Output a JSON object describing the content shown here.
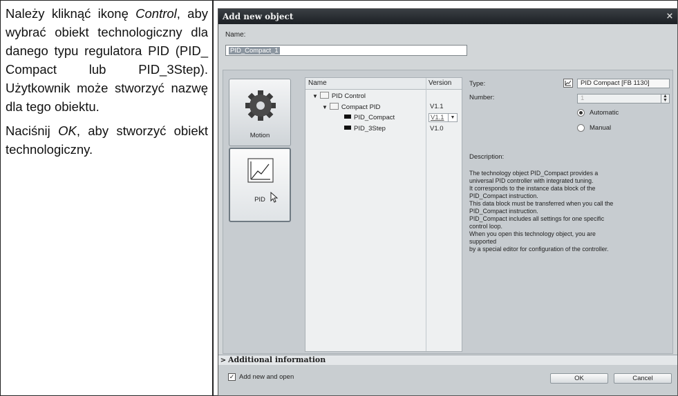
{
  "instructions": {
    "para1": "Należy kliknąć ikonę Control, aby wybrać obiekt technologiczny dla danego typu regulatora PID (PID_Compact lub PID_3Step). Użytkownik może stworzyć nazwę dla tego obiektu.",
    "para1_before": "Należy kliknąć ikonę ",
    "para1_em": "Control",
    "para1_after": ", aby wybrać obiekt technologiczny dla danego typu regulatora PID (PID_ Compact lub PID_3Step). Użytkownik może stworzyć nazwę dla tego obiektu.",
    "para2_before": "Naciśnij ",
    "para2_em": "OK",
    "para2_after": ", aby stworzyć obiekt technologiczny."
  },
  "dialog": {
    "title": "Add new object",
    "close_glyph": "×",
    "name_label": "Name:",
    "name_value": "PID_Compact_1",
    "categories": [
      {
        "label": "Motion",
        "icon": "gear-icon"
      },
      {
        "label": "PID",
        "icon": "pid-chart-icon"
      }
    ],
    "tree": {
      "col_name": "Name",
      "col_version": "Version",
      "rows": [
        {
          "label": "PID Control",
          "version": ""
        },
        {
          "label": "Compact PID",
          "version": "V1.1"
        },
        {
          "label": "PID_Compact",
          "version": "V1.1"
        },
        {
          "label": "PID_3Step",
          "version": "V1.0"
        }
      ]
    },
    "details": {
      "type_label": "Type:",
      "type_value": "PID Compact [FB 1130]",
      "number_label": "Number:",
      "number_value": "1",
      "radio_automatic": "Automatic",
      "radio_manual": "Manual",
      "selected_mode": "Automatic",
      "description_label": "Description:",
      "description_lines": [
        "The technology object PID_Compact provides a",
        "universal PID controller with integrated tuning.",
        "It corresponds to the instance data block of the",
        "PID_Compact instruction.",
        "This data block must be transferred when you call the",
        "PID_Compact instruction.",
        "PID_Compact includes all settings for one specific",
        "control loop.",
        "When you open this technology object, you are",
        "supported",
        "by a special editor for configuration of the controller."
      ]
    },
    "additional_information": "Additional information",
    "add_new_and_open": "Add new and open",
    "add_new_and_open_checked": true,
    "ok_label": "OK",
    "cancel_label": "Cancel"
  }
}
